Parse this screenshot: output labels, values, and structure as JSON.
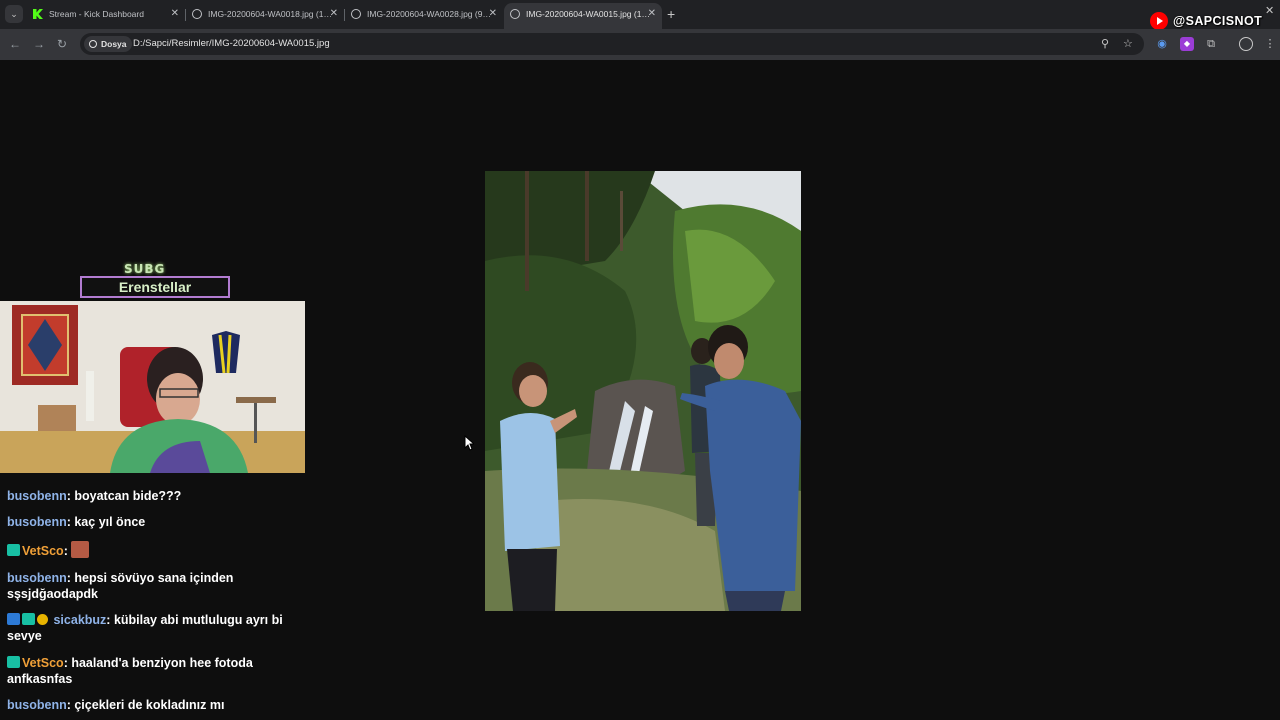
{
  "tabs": [
    {
      "title": "Stream - Kick Dashboard",
      "icon": "kick-icon",
      "active": false
    },
    {
      "title": "IMG-20200604-WA0018.jpg (1…",
      "icon": "globe-icon",
      "active": false
    },
    {
      "title": "IMG-20200604-WA0028.jpg (9…",
      "icon": "globe-icon",
      "active": false
    },
    {
      "title": "IMG-20200604-WA0015.jpg (1…",
      "icon": "globe-icon",
      "active": true
    }
  ],
  "overlay": {
    "channel_handle": "@SAPCISNOT"
  },
  "address": {
    "chip_label": "Dosya",
    "url": "D:/Sapci/Resimler/IMG-20200604-WA0015.jpg"
  },
  "stream": {
    "badge_text": "SUBG",
    "streamer_name": "Erenstellar"
  },
  "chat": [
    {
      "user": "busobenn",
      "text": "boyatcan bide???",
      "badges": [],
      "user_color": "blue"
    },
    {
      "user": "busobenn",
      "text": "kaç yıl önce",
      "badges": [],
      "user_color": "blue"
    },
    {
      "user": "VetSco",
      "text": "",
      "badges": [
        "sub"
      ],
      "user_color": "orange",
      "emote": true
    },
    {
      "user": "busobenn",
      "text": "hepsi sövüyo sana içinden sşsjdğaodapdk",
      "badges": [],
      "user_color": "blue"
    },
    {
      "user": "sicakbuz",
      "text": "kübilay abi mutlulugu ayrı bi sevye",
      "badges": [
        "prime",
        "sub",
        "gold"
      ],
      "user_color": "blue"
    },
    {
      "user": "VetSco",
      "text": "haaland'a benziyon hee fotoda anfkasnfas",
      "badges": [
        "sub"
      ],
      "user_color": "orange"
    },
    {
      "user": "busobenn",
      "text": "çiçekleri de kokladınız mı",
      "badges": [],
      "user_color": "blue"
    }
  ],
  "colors": {
    "chrome_dark": "#202124",
    "chrome_toolbar": "#35363a",
    "viewer_bg": "#0e0e0e",
    "chat_user_blue": "#8fb3e8",
    "chat_user_orange": "#f0a038"
  }
}
